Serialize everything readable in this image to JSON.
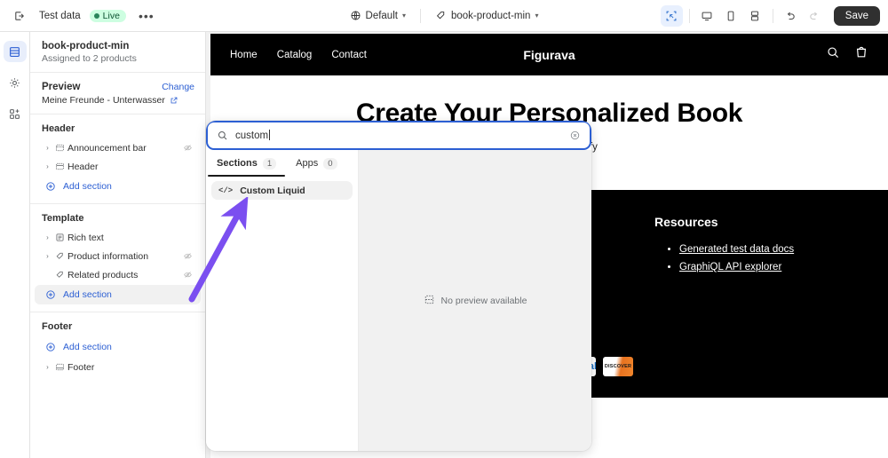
{
  "topbar": {
    "back_icon": "exit-icon",
    "title": "Test data",
    "status": "Live",
    "more": "•••",
    "market": "Default",
    "template": "book-product-min",
    "device_desktop": "desktop-icon",
    "device_mobile": "mobile-icon",
    "device_full": "fullscreen-icon",
    "undo": "undo-icon",
    "redo": "redo-icon",
    "save_label": "Save"
  },
  "rail": {
    "items": [
      {
        "name": "sections",
        "label": "Sections"
      },
      {
        "name": "settings",
        "label": "Theme settings"
      },
      {
        "name": "apps",
        "label": "Apps"
      }
    ]
  },
  "sidebar": {
    "template_name": "book-product-min",
    "assigned": "Assigned to 2 products",
    "preview_label": "Preview",
    "change_label": "Change",
    "preview_value": "Meine Freunde - Unterwasser",
    "groups": [
      {
        "label": "Header",
        "items": [
          {
            "label": "Announcement bar",
            "icon": "announcement-icon",
            "caret": true,
            "hidden": true
          },
          {
            "label": "Header",
            "icon": "header-icon",
            "caret": true,
            "hidden": false
          }
        ],
        "add_label": "Add section",
        "add_highlight": false
      },
      {
        "label": "Template",
        "items": [
          {
            "label": "Rich text",
            "icon": "richtext-icon",
            "caret": true,
            "hidden": false
          },
          {
            "label": "Product information",
            "icon": "product-icon",
            "caret": true,
            "hidden": true
          },
          {
            "label": "Related products",
            "icon": "related-icon",
            "caret": false,
            "hidden": true
          }
        ],
        "add_label": "Add section",
        "add_highlight": true
      },
      {
        "label": "Footer",
        "items": [],
        "add_label": "Add section",
        "add_highlight": false,
        "after_items": [
          {
            "label": "Footer",
            "icon": "footer-icon",
            "caret": true,
            "hidden": false
          }
        ]
      }
    ]
  },
  "modal": {
    "search_value": "custom",
    "search_icon": "search-icon",
    "clear_icon": "clear-circle-icon",
    "tabs": [
      {
        "label": "Sections",
        "count": "1",
        "active": true
      },
      {
        "label": "Apps",
        "count": "0",
        "active": false
      }
    ],
    "results": [
      {
        "label": "Custom Liquid",
        "icon": "code-icon"
      }
    ],
    "preview_empty_text": "No preview available",
    "preview_empty_icon": "preview-placeholder-icon"
  },
  "preview": {
    "nav": [
      "Home",
      "Catalog",
      "Contact"
    ],
    "brand": "Figurava",
    "search_icon": "search-icon",
    "cart_icon": "cart-icon",
    "heading": "Create Your Personalized Book",
    "subheading": "with Uhuu on Shopify",
    "resources_title": "Resources",
    "resource_links": [
      "Generated test data docs",
      "GraphiQL API explorer"
    ],
    "payments": [
      "PayPal",
      "DISCOVER"
    ]
  },
  "colors": {
    "accent_blue": "#2c5fd3",
    "arrow_purple": "#7b4ff0",
    "live_green": "#0c5132",
    "save_dark": "#303030"
  }
}
